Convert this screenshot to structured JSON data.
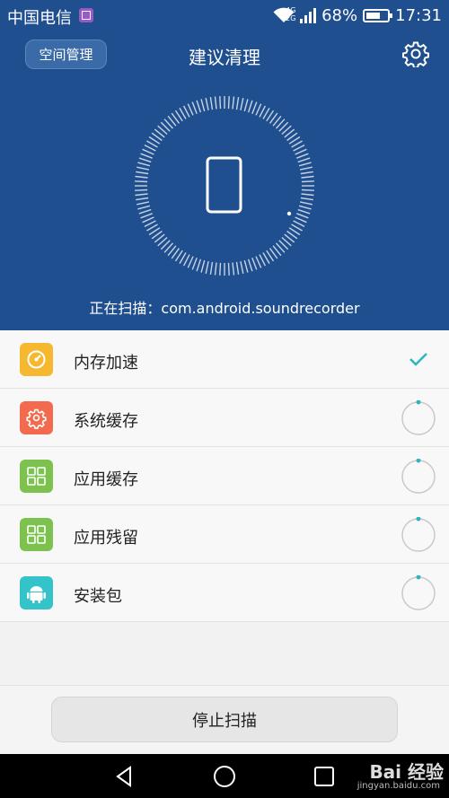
{
  "status_bar": {
    "carrier": "中国电信",
    "net_small": "4G\n2G",
    "battery": "68%",
    "battery_level": 0.68,
    "time": "17:31"
  },
  "header": {
    "space_button": "空间管理",
    "title": "建议清理"
  },
  "scan": {
    "text": "正在扫描：com.android.soundrecorder"
  },
  "items": [
    {
      "label": "内存加速",
      "icon": "speed-icon",
      "color": "#f5b82e",
      "state": "done"
    },
    {
      "label": "系统缓存",
      "icon": "gear-icon",
      "color": "#f26b4f",
      "state": "scanning"
    },
    {
      "label": "应用缓存",
      "icon": "grid-icon",
      "color": "#7dc24f",
      "state": "scanning"
    },
    {
      "label": "应用残留",
      "icon": "grid-icon",
      "color": "#7dc24f",
      "state": "scanning"
    },
    {
      "label": "安装包",
      "icon": "android-icon",
      "color": "#33c3c9",
      "state": "scanning"
    }
  ],
  "footer": {
    "stop_button": "停止扫描"
  },
  "watermark": {
    "text": "Bai  经验",
    "sub": "jingyan.baidu.com"
  },
  "colors": {
    "header_bg": "#1f4f8f",
    "accent": "#2bb6c2"
  }
}
